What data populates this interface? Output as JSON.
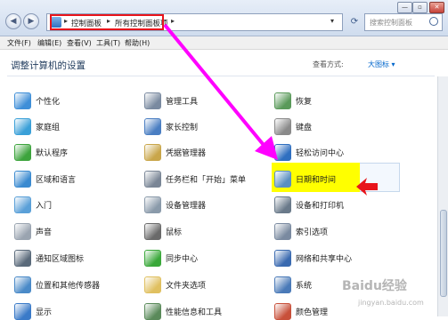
{
  "address": {
    "crumbs": [
      "控制面板",
      "所有控制面板项"
    ],
    "search_placeholder": "搜索控制面板"
  },
  "menu": [
    "文件(F)",
    "编辑(E)",
    "查看(V)",
    "工具(T)",
    "帮助(H)"
  ],
  "content": {
    "heading": "调整计算机的设置",
    "view_by_label": "查看方式:",
    "view_by_value": "大图标 ▾"
  },
  "items": [
    {
      "label": "个性化",
      "icon": "personalization-icon",
      "color": "#3f8fd8"
    },
    {
      "label": "管理工具",
      "icon": "admin-tools-icon",
      "color": "#7a8aa0"
    },
    {
      "label": "恢复",
      "icon": "recovery-icon",
      "color": "#5a9a5a"
    },
    {
      "label": "家庭组",
      "icon": "homegroup-icon",
      "color": "#3aa0d8"
    },
    {
      "label": "家长控制",
      "icon": "parental-controls-icon",
      "color": "#4a7ec2"
    },
    {
      "label": "键盘",
      "icon": "keyboard-icon",
      "color": "#8a8a8a"
    },
    {
      "label": "默认程序",
      "icon": "default-programs-icon",
      "color": "#3da43d"
    },
    {
      "label": "凭据管理器",
      "icon": "credential-manager-icon",
      "color": "#c9a64a"
    },
    {
      "label": "轻松访问中心",
      "icon": "ease-of-access-icon",
      "color": "#2f6fc0"
    },
    {
      "label": "区域和语言",
      "icon": "region-language-icon",
      "color": "#3a8ad0"
    },
    {
      "label": "任务栏和「开始」菜单",
      "icon": "taskbar-icon",
      "color": "#7a8696"
    },
    {
      "label": "日期和时间",
      "icon": "date-time-icon",
      "color": "#5a8fc0"
    },
    {
      "label": "入门",
      "icon": "getting-started-icon",
      "color": "#5aa0d8"
    },
    {
      "label": "设备管理器",
      "icon": "device-manager-icon",
      "color": "#8a9aaa"
    },
    {
      "label": "设备和打印机",
      "icon": "devices-printers-icon",
      "color": "#6a7a8a"
    },
    {
      "label": "声音",
      "icon": "sound-icon",
      "color": "#9aa4b0"
    },
    {
      "label": "鼠标",
      "icon": "mouse-icon",
      "color": "#6a6a6a"
    },
    {
      "label": "索引选项",
      "icon": "indexing-options-icon",
      "color": "#7a8aa0"
    },
    {
      "label": "通知区域图标",
      "icon": "notification-area-icon",
      "color": "#5a6a7a"
    },
    {
      "label": "同步中心",
      "icon": "sync-center-icon",
      "color": "#3aa83a"
    },
    {
      "label": "网络和共享中心",
      "icon": "network-sharing-icon",
      "color": "#3a6ab0"
    },
    {
      "label": "位置和其他传感器",
      "icon": "location-sensors-icon",
      "color": "#4a8ac8"
    },
    {
      "label": "文件夹选项",
      "icon": "folder-options-icon",
      "color": "#e0c060"
    },
    {
      "label": "系统",
      "icon": "system-icon",
      "color": "#4a7ab8"
    },
    {
      "label": "显示",
      "icon": "display-icon",
      "color": "#3a7ac8"
    },
    {
      "label": "性能信息和工具",
      "icon": "performance-icon",
      "color": "#5a8a5a"
    },
    {
      "label": "颜色管理",
      "icon": "color-management-icon",
      "color": "#c8503a"
    }
  ],
  "watermark": {
    "logo": "Baidu经验",
    "url": "jingyan.baidu.com"
  },
  "highlight_color": "#ffff00",
  "arrow_color": "#ff00ff"
}
